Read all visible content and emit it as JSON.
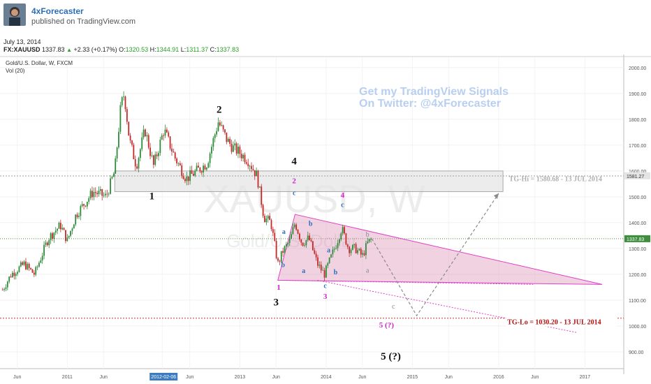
{
  "header": {
    "author": "4xForecaster",
    "published": "published on TradingView.com"
  },
  "date_line": "July 13, 2014",
  "ohlc": {
    "symbol": "FX:XAUUSD",
    "last": "1337.83",
    "change": "+2.33 (+0.17%)",
    "o_label": "O:",
    "o": "1320.53",
    "h_label": "H:",
    "h": "1344.91",
    "l_label": "L:",
    "l": "1311.37",
    "c_label": "C:",
    "c": "1337.83"
  },
  "chart_titles": {
    "symbol_title": "Gold/U.S. Dollar, W, FXCM",
    "volume_title": "Vol (20)"
  },
  "colors": {
    "candle_up": "#2e8b3a",
    "candle_down": "#c62828",
    "triangle_fill": "#d98fb5",
    "triangle_line": "#e040c8",
    "resistance_zone": "#e6e6e6",
    "tg_lo": "#d32f2f",
    "signal_text": "#b9cff0",
    "price_line": "#5a8c3a"
  },
  "chart_data": {
    "type": "candlestick",
    "watermark": "XAUUSD, W",
    "watermark_sub": "Gold/U.S. Dollar",
    "promo_text": [
      "Get my TradingView Signals",
      "On Twitter: @4xForecaster"
    ],
    "yaxis": {
      "ticks": [
        2000,
        1900,
        1800,
        1700,
        1600,
        1500,
        1400,
        1300,
        1200,
        1100,
        1000,
        900
      ],
      "tick_labels": [
        "2000.00",
        "1900.00",
        "1800.00",
        "1700.00",
        "1600.00",
        "1500.00",
        "1400.00",
        "1300.00",
        "1200.00",
        "1100.00",
        "1000.00",
        "900.00"
      ],
      "ylim": [
        835,
        2040
      ],
      "price_tag": "1581.27",
      "last_price_tag": "1337.83",
      "tg_lo_tag": "1030.20"
    },
    "xaxis": {
      "tick_labels": [
        "Jun",
        "2011",
        "Jun",
        "2012-02-06",
        "Jun",
        "2013",
        "Jun",
        "2014",
        "Jun",
        "2015",
        "Jun",
        "2016",
        "Jun",
        "2017"
      ],
      "tick_years": [
        2010.42,
        2011.0,
        2011.42,
        2012.1,
        2012.42,
        2013.0,
        2013.42,
        2014.0,
        2014.42,
        2015.0,
        2015.42,
        2016.0,
        2016.42,
        2017.0
      ],
      "highlight_label": "2012-02-06",
      "xlim": [
        2010.22,
        2017.45
      ]
    },
    "price_path": [
      [
        2010.25,
        1140
      ],
      [
        2010.35,
        1200
      ],
      [
        2010.5,
        1240
      ],
      [
        2010.62,
        1200
      ],
      [
        2010.78,
        1340
      ],
      [
        2010.92,
        1390
      ],
      [
        2011.0,
        1330
      ],
      [
        2011.1,
        1430
      ],
      [
        2011.3,
        1520
      ],
      [
        2011.45,
        1500
      ],
      [
        2011.55,
        1600
      ],
      [
        2011.62,
        1850
      ],
      [
        2011.66,
        1900
      ],
      [
        2011.72,
        1720
      ],
      [
        2011.8,
        1620
      ],
      [
        2011.9,
        1760
      ],
      [
        2012.0,
        1620
      ],
      [
        2012.12,
        1760
      ],
      [
        2012.25,
        1650
      ],
      [
        2012.38,
        1570
      ],
      [
        2012.5,
        1600
      ],
      [
        2012.62,
        1630
      ],
      [
        2012.75,
        1790
      ],
      [
        2012.85,
        1720
      ],
      [
        2012.92,
        1690
      ],
      [
        2013.0,
        1670
      ],
      [
        2013.1,
        1640
      ],
      [
        2013.2,
        1580
      ],
      [
        2013.28,
        1420
      ],
      [
        2013.36,
        1400
      ],
      [
        2013.44,
        1240
      ],
      [
        2013.5,
        1290
      ],
      [
        2013.58,
        1330
      ],
      [
        2013.64,
        1400
      ],
      [
        2013.72,
        1320
      ],
      [
        2013.8,
        1340
      ],
      [
        2013.9,
        1240
      ],
      [
        2013.98,
        1200
      ],
      [
        2014.05,
        1260
      ],
      [
        2014.12,
        1320
      ],
      [
        2014.18,
        1380
      ],
      [
        2014.26,
        1300
      ],
      [
        2014.34,
        1300
      ],
      [
        2014.42,
        1270
      ],
      [
        2014.48,
        1320
      ],
      [
        2014.53,
        1338
      ]
    ],
    "shapes": {
      "resistance_zone": {
        "x1": 2011.55,
        "x2": 2016.05,
        "y1": 1520,
        "y2": 1600
      },
      "tg_hi_line": 1580.68,
      "tg_lo_line": 1030.2,
      "last_price_line": 1337.83,
      "triangle": [
        [
          2013.64,
          1432
        ],
        [
          2013.44,
          1177
        ],
        [
          2017.2,
          1161
        ]
      ],
      "lower_dotted": [
        [
          2013.9,
          1177
        ],
        [
          2016.9,
          975
        ]
      ],
      "projection": [
        [
          2014.53,
          1338
        ],
        [
          2015.05,
          1040
        ],
        [
          2016.0,
          1513
        ]
      ]
    },
    "annotations": [
      {
        "text": "TG-Hi = 1580.68 - 13 JUL 2014",
        "x": 2016.12,
        "y": 1560,
        "style": "tghi"
      },
      {
        "text": "TG-Lo = 1030.20 - 13 JUL 2014",
        "x": 2016.1,
        "y": 1006,
        "style": "tglo"
      },
      {
        "text": "1",
        "x": 2011.98,
        "y": 1490,
        "style": "black"
      },
      {
        "text": "2",
        "x": 2012.76,
        "y": 1825,
        "style": "black"
      },
      {
        "text": "3",
        "x": 2013.42,
        "y": 1080,
        "style": "black"
      },
      {
        "text": "4",
        "x": 2013.63,
        "y": 1625,
        "style": "black"
      },
      {
        "text": "5 (?)",
        "x": 2014.75,
        "y": 870,
        "style": "black"
      },
      {
        "text": "2",
        "x": 2013.63,
        "y": 1552,
        "style": "magenta"
      },
      {
        "text": "c",
        "x": 2013.63,
        "y": 1507,
        "style": "blue"
      },
      {
        "text": "a",
        "x": 2013.51,
        "y": 1357,
        "style": "blue"
      },
      {
        "text": "b",
        "x": 2013.5,
        "y": 1228,
        "style": "blue"
      },
      {
        "text": "1",
        "x": 2013.45,
        "y": 1140,
        "style": "magenta"
      },
      {
        "text": "b",
        "x": 2013.82,
        "y": 1387,
        "style": "blue"
      },
      {
        "text": "a",
        "x": 2013.74,
        "y": 1205,
        "style": "blue"
      },
      {
        "text": "c",
        "x": 2013.99,
        "y": 1147,
        "style": "blue"
      },
      {
        "text": "3",
        "x": 2013.99,
        "y": 1105,
        "style": "magenta"
      },
      {
        "text": "a",
        "x": 2014.03,
        "y": 1285,
        "style": "blue"
      },
      {
        "text": "b",
        "x": 2014.11,
        "y": 1200,
        "style": "blue"
      },
      {
        "text": "4",
        "x": 2014.19,
        "y": 1497,
        "style": "magenta"
      },
      {
        "text": "c",
        "x": 2014.19,
        "y": 1460,
        "style": "blue"
      },
      {
        "text": "b",
        "x": 2014.48,
        "y": 1345,
        "style": "grey"
      },
      {
        "text": "a",
        "x": 2014.48,
        "y": 1206,
        "style": "grey"
      },
      {
        "text": "c",
        "x": 2014.78,
        "y": 1068,
        "style": "grey"
      },
      {
        "text": "5 (?)",
        "x": 2014.7,
        "y": 995,
        "style": "magenta"
      }
    ]
  }
}
